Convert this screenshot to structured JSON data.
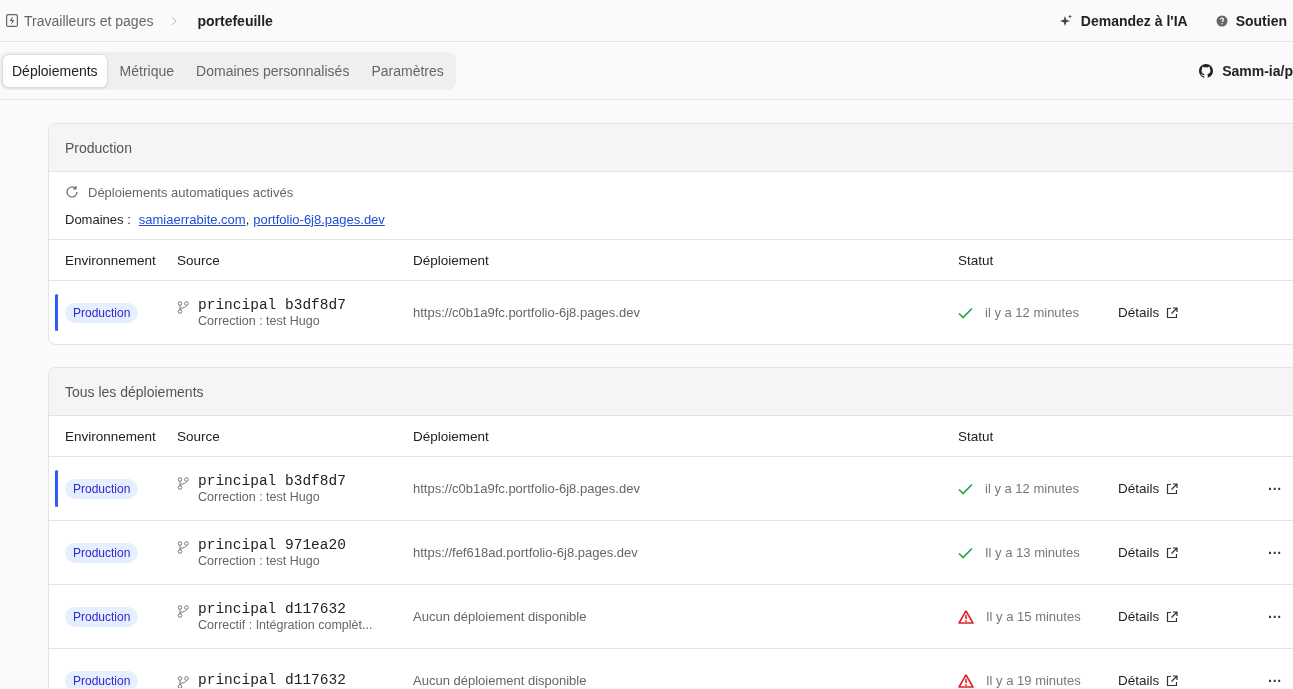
{
  "breadcrumb": {
    "parent": "Travailleurs et pages",
    "current": "portefeuille"
  },
  "header_actions": [
    {
      "kind": "ai",
      "label": "Demandez à l'IA"
    },
    {
      "kind": "help",
      "label": "Soutien"
    }
  ],
  "tabs": [
    {
      "label": "Déploiements",
      "selected": true
    },
    {
      "label": "Métrique",
      "selected": false
    },
    {
      "label": "Domaines personnalisés",
      "selected": false
    },
    {
      "label": "Paramètres",
      "selected": false
    }
  ],
  "repo": "Samm-ia/p",
  "production": {
    "title": "Production",
    "auto_deploy": "Déploiements automatiques activés",
    "domains_label": "Domaines :",
    "domains": [
      "samiaerrabite.com",
      "portfolio-6j8.pages.dev"
    ],
    "domain_separator": ",",
    "columns": [
      "Environnement",
      "Source",
      "Déploiement",
      "Statut"
    ],
    "rows": [
      {
        "environment": "Production",
        "current": true,
        "branch": "principal b3df8d7",
        "message": "Correction : test Hugo",
        "deployment": "https://c0b1a9fc.portfolio-6j8.pages.dev",
        "kind": "good",
        "time": "il y a 12 minutes",
        "details": "Détails"
      }
    ]
  },
  "all_deployments": {
    "title": "Tous les déploiements",
    "columns": [
      "Environnement",
      "Source",
      "Déploiement",
      "Statut"
    ],
    "rows": [
      {
        "environment": "Production",
        "current": true,
        "branch": "principal b3df8d7",
        "message": "Correction : test Hugo",
        "deployment": "https://c0b1a9fc.portfolio-6j8.pages.dev",
        "kind": "good",
        "time": "il y a 12 minutes",
        "details": "Détails",
        "menu": "···"
      },
      {
        "environment": "Production",
        "current": false,
        "branch": "principal 971ea20",
        "message": "Correction : test Hugo",
        "deployment": "https://fef618ad.portfolio-6j8.pages.dev",
        "kind": "good",
        "time": "Il y a 13 minutes",
        "details": "Détails",
        "menu": "···"
      },
      {
        "environment": "Production",
        "current": false,
        "branch": "principal d117632",
        "message": "Correctif : Intégration complèt...",
        "deployment": "Aucun déploiement disponible",
        "kind": "bad",
        "time": "Il y a 15 minutes",
        "details": "Détails",
        "menu": "···"
      },
      {
        "environment": "Production",
        "current": false,
        "branch": "principal d117632",
        "deployment": "Aucun déploiement disponible",
        "kind": "bad",
        "time": "Il y a 19 minutes",
        "details": "Détails",
        "menu": "···"
      }
    ]
  }
}
